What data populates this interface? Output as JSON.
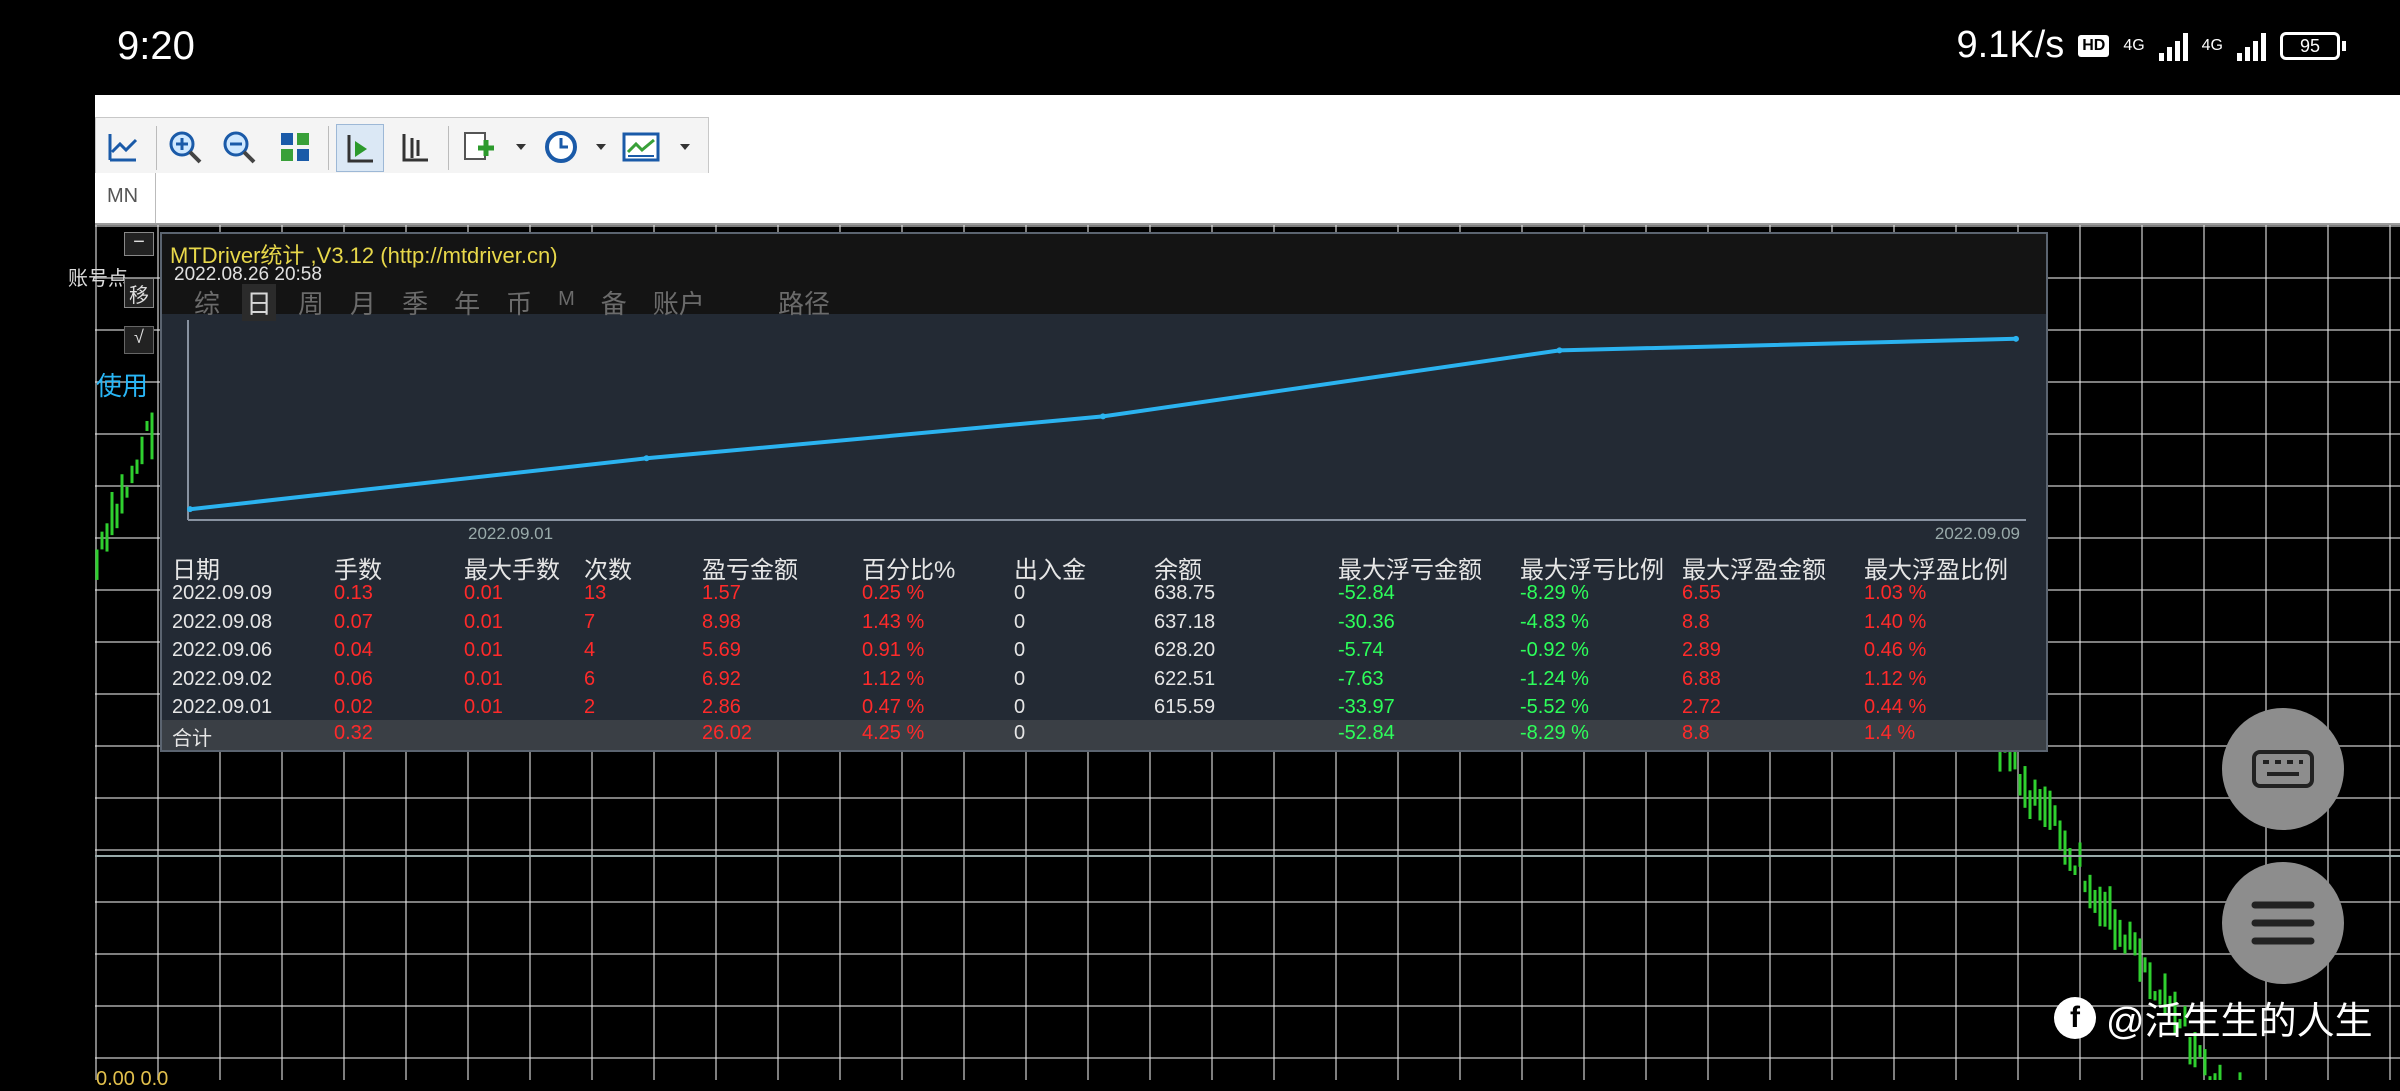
{
  "status_bar": {
    "time": "9:20",
    "net_speed": "9.1K/s",
    "hd": "HD",
    "net1": "4G",
    "net2": "4G",
    "battery": "95"
  },
  "toolbar": {
    "timeframe": "MN"
  },
  "left_panel": {
    "min_btn": "−",
    "move_btn": "移",
    "check_btn": "√",
    "side_label": "账号点",
    "use_label": "使用",
    "bottom_label": "0.00 0.0"
  },
  "panel": {
    "title": "MTDriver统计 ,V3.12 (http://mtdriver.cn)",
    "timestamp": "2022.08.26 20:58",
    "tabs": [
      "综",
      "日",
      "周",
      "月",
      "季",
      "年",
      "币",
      "M",
      "备",
      "账户"
    ],
    "active_tab": 1,
    "path_tab": "路径",
    "axis_left": "2022.09.01",
    "axis_right": "2022.09.09"
  },
  "equity_curve": {
    "values": [
      615.59,
      622.51,
      628.2,
      637.18,
      638.75
    ]
  },
  "stats": {
    "headers": [
      "日期",
      "手数",
      "最大手数",
      "次数",
      "盈亏金额",
      "百分比%",
      "出入金",
      "余额",
      "最大浮亏金额",
      "最大浮亏比例",
      "最大浮盈金额",
      "最大浮盈比例"
    ],
    "rows": [
      [
        "2022.09.09",
        "0.13",
        "0.01",
        "13",
        "1.57",
        "0.25 %",
        "0",
        "638.75",
        "-52.84",
        "-8.29 %",
        "6.55",
        "1.03 %"
      ],
      [
        "2022.09.08",
        "0.07",
        "0.01",
        "7",
        "8.98",
        "1.43 %",
        "0",
        "637.18",
        "-30.36",
        "-4.83 %",
        "8.8",
        "1.40 %"
      ],
      [
        "2022.09.06",
        "0.04",
        "0.01",
        "4",
        "5.69",
        "0.91 %",
        "0",
        "628.20",
        "-5.74",
        "-0.92 %",
        "2.89",
        "0.46 %"
      ],
      [
        "2022.09.02",
        "0.06",
        "0.01",
        "6",
        "6.92",
        "1.12 %",
        "0",
        "622.51",
        "-7.63",
        "-1.24 %",
        "6.88",
        "1.12 %"
      ],
      [
        "2022.09.01",
        "0.02",
        "0.01",
        "2",
        "2.86",
        "0.47 %",
        "0",
        "615.59",
        "-33.97",
        "-5.52 %",
        "2.72",
        "0.44 %"
      ]
    ],
    "total": [
      "合计",
      "0.32",
      "",
      "",
      "26.02",
      "4.25 %",
      "0",
      "",
      "-52.84",
      "-8.29 %",
      "8.8",
      "1.4 %"
    ]
  },
  "watermark": {
    "handle": "@活生生的人生"
  },
  "colors": {
    "curve": "#2bb3f0",
    "loss": "#2dff5a",
    "profit": "#ff2a2a",
    "candle": "#2fd02f"
  }
}
